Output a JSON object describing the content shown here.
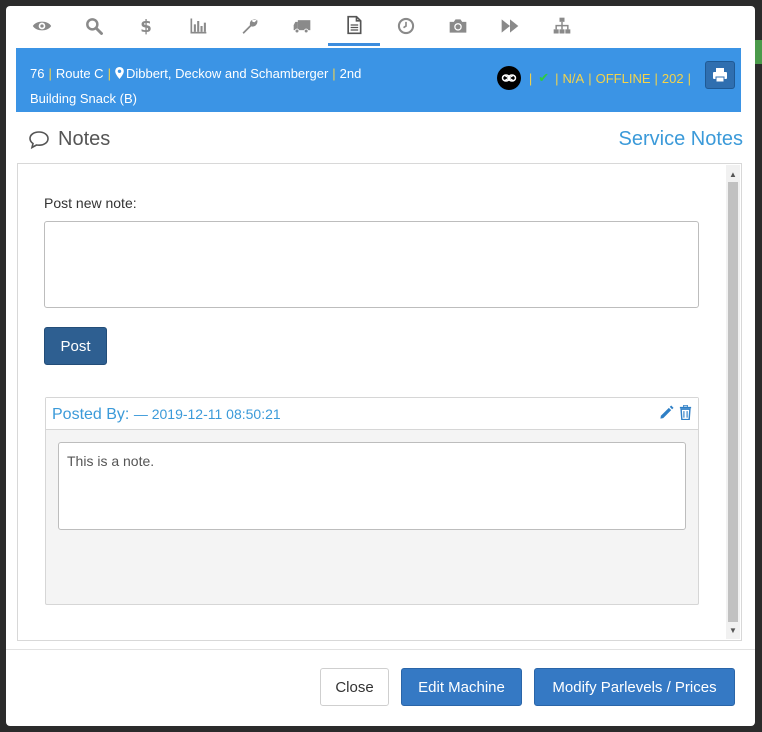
{
  "tabs": [
    {
      "icon": "eye-icon"
    },
    {
      "icon": "search-icon"
    },
    {
      "icon": "dollar-icon"
    },
    {
      "icon": "bar-chart-icon"
    },
    {
      "icon": "wrench-icon"
    },
    {
      "icon": "truck-icon"
    },
    {
      "icon": "document-icon",
      "active": true
    },
    {
      "icon": "clock-icon"
    },
    {
      "icon": "camera-icon"
    },
    {
      "icon": "fast-forward-icon"
    },
    {
      "icon": "sitemap-icon"
    }
  ],
  "info": {
    "machine_number": "76",
    "route": "Route C",
    "location": "Dibbert, Deckow and Schamberger",
    "line1_tail": "2nd",
    "line2": "Building Snack (B)",
    "na": "N/A",
    "status": "OFFLINE",
    "code": "202"
  },
  "notes": {
    "title": "Notes",
    "service_link": "Service Notes",
    "post_label": "Post new note:",
    "new_note_value": "",
    "post_button": "Post"
  },
  "note_entry": {
    "posted_by_label": "Posted By:",
    "date": "— 2019-12-11 08:50:21",
    "text": "This is a note."
  },
  "footer": {
    "close": "Close",
    "edit_machine": "Edit Machine",
    "modify": "Modify Parlevels / Prices"
  },
  "colors": {
    "accent": "#3b94e5",
    "status_yellow": "#f3d34a",
    "check_green": "#2ecc40",
    "link_blue": "#3b9ad9",
    "primary_button": "#3579c4"
  }
}
